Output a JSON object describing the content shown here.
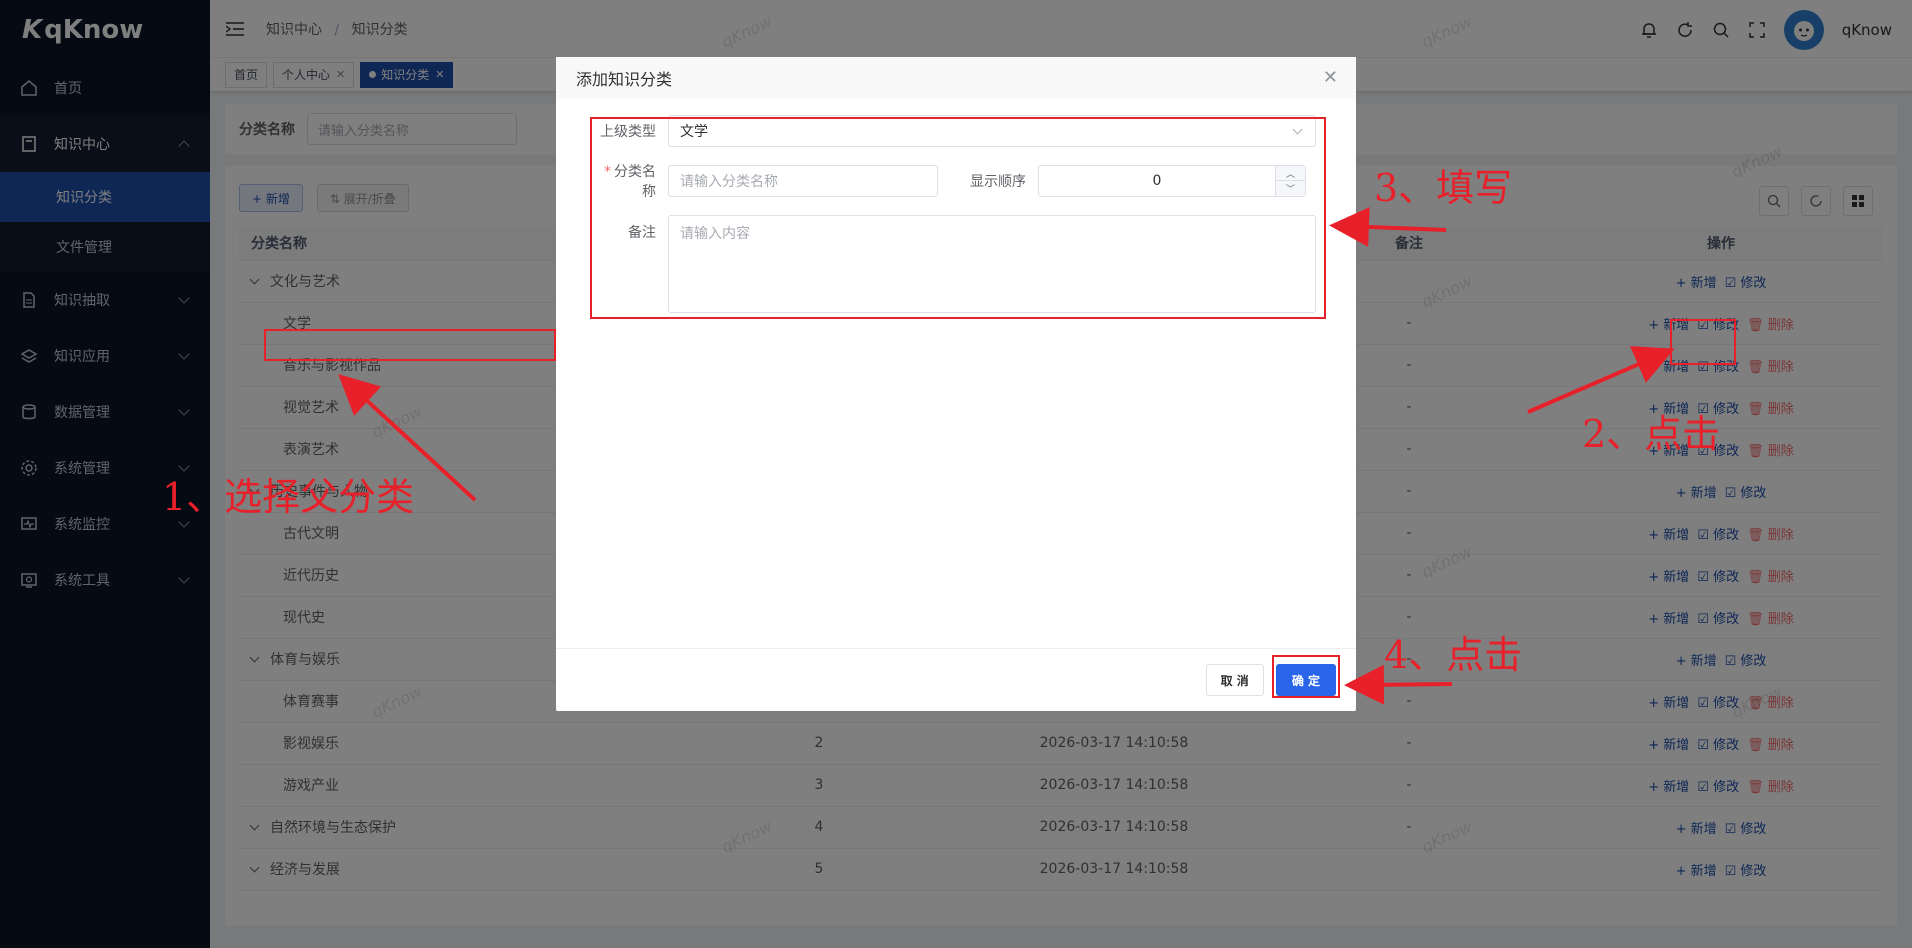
{
  "app": {
    "logo": "qKnow"
  },
  "sidebar": {
    "items": [
      {
        "label": "首页",
        "icon": "home-icon"
      },
      {
        "label": "知识中心",
        "icon": "book-icon",
        "open": true,
        "children": [
          {
            "label": "知识分类",
            "active": true
          },
          {
            "label": "文件管理"
          }
        ]
      },
      {
        "label": "知识抽取",
        "icon": "document-icon"
      },
      {
        "label": "知识应用",
        "icon": "layers-icon"
      },
      {
        "label": "数据管理",
        "icon": "database-icon"
      },
      {
        "label": "系统管理",
        "icon": "gear-icon"
      },
      {
        "label": "系统监控",
        "icon": "monitor-icon"
      },
      {
        "label": "系统工具",
        "icon": "tool-icon"
      }
    ]
  },
  "header": {
    "breadcrumb": [
      "知识中心",
      "知识分类"
    ],
    "username": "qKnow"
  },
  "tags": [
    {
      "label": "首页"
    },
    {
      "label": "个人中心",
      "closable": true
    },
    {
      "label": "知识分类",
      "closable": true,
      "active": true
    }
  ],
  "search": {
    "label": "分类名称",
    "placeholder": "请输入分类名称"
  },
  "toolbar": {
    "add": "+ 新增",
    "expand": "⇅ 展开/折叠"
  },
  "table": {
    "headers": {
      "name": "分类名称",
      "remark": "备注",
      "op": "操作"
    },
    "ops": {
      "add": "+ 新增",
      "edit": "☑ 修改",
      "del": "🗑 删除"
    },
    "rows": [
      {
        "name": "文化与艺术",
        "level": 0,
        "order": "",
        "time": "",
        "remark": "",
        "del": false
      },
      {
        "name": "文学",
        "level": 1,
        "order": "",
        "time": "",
        "remark": "-",
        "del": true
      },
      {
        "name": "音乐与影视作品",
        "level": 1,
        "order": "",
        "time": "",
        "remark": "-",
        "del": true
      },
      {
        "name": "视觉艺术",
        "level": 1,
        "order": "",
        "time": "",
        "remark": "-",
        "del": true
      },
      {
        "name": "表演艺术",
        "level": 1,
        "order": "",
        "time": "",
        "remark": "-",
        "del": true
      },
      {
        "name": "历史事件与人物",
        "level": 0,
        "order": "",
        "time": "",
        "remark": "-",
        "del": false
      },
      {
        "name": "古代文明",
        "level": 1,
        "order": "",
        "time": "",
        "remark": "-",
        "del": true
      },
      {
        "name": "近代历史",
        "level": 1,
        "order": "",
        "time": "",
        "remark": "-",
        "del": true
      },
      {
        "name": "现代史",
        "level": 1,
        "order": "",
        "time": "",
        "remark": "-",
        "del": true
      },
      {
        "name": "体育与娱乐",
        "level": 0,
        "order": "",
        "time": "",
        "remark": "-",
        "del": false
      },
      {
        "name": "体育赛事",
        "level": 1,
        "order": "1",
        "time": "2026-03-17 14:10:58",
        "remark": "-",
        "del": true
      },
      {
        "name": "影视娱乐",
        "level": 1,
        "order": "2",
        "time": "2026-03-17 14:10:58",
        "remark": "-",
        "del": true
      },
      {
        "name": "游戏产业",
        "level": 1,
        "order": "3",
        "time": "2026-03-17 14:10:58",
        "remark": "-",
        "del": true
      },
      {
        "name": "自然环境与生态保护",
        "level": 0,
        "order": "4",
        "time": "2026-03-17 14:10:58",
        "remark": "-",
        "del": false
      },
      {
        "name": "经济与发展",
        "level": 0,
        "order": "5",
        "time": "2026-03-17 14:10:58",
        "remark": "",
        "del": false
      }
    ]
  },
  "dialog": {
    "title": "添加知识分类",
    "parent_label": "上级类型",
    "parent_value": "文学",
    "name_label": "分类名称",
    "name_placeholder": "请输入分类名称",
    "order_label": "显示顺序",
    "order_value": "0",
    "remark_label": "备注",
    "remark_placeholder": "请输入内容",
    "cancel": "取 消",
    "ok": "确 定"
  },
  "annotations": {
    "step1": "1、选择父分类",
    "step2": "2、点击",
    "step3": "3、填写",
    "step4": "4、点击",
    "color": "#e8202a"
  },
  "watermark": "qKnow"
}
